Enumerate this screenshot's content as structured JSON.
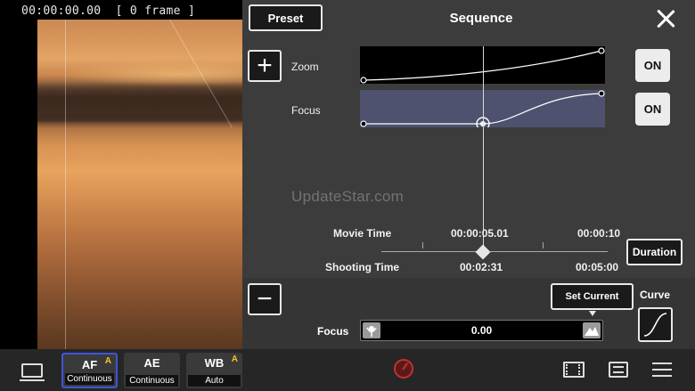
{
  "preview": {
    "timecode": "00:00:00.00",
    "frame_count": "[ 0 frame ]"
  },
  "sequence": {
    "title": "Sequence",
    "preset_label": "Preset",
    "close_icon": "close-icon",
    "add_label": "+",
    "remove_label": "−",
    "tracks": [
      {
        "label": "Zoom",
        "toggle": "ON"
      },
      {
        "label": "Focus",
        "toggle": "ON"
      }
    ],
    "watermark": "UpdateStar.com",
    "timeline": {
      "movie_time_label": "Movie Time",
      "shooting_time_label": "Shooting Time",
      "movie_time_current": "00:00:05.01",
      "movie_time_end": "00:00:10",
      "shooting_time_current": "00:02:31",
      "shooting_time_end": "00:05:00",
      "duration_label": "Duration"
    },
    "set_current_label": "Set Current",
    "curve_label": "Curve",
    "focus_slider": {
      "label": "Focus",
      "value": "0.00",
      "near_icon": "flower-icon",
      "far_icon": "mountain-icon"
    }
  },
  "toolbar": {
    "display_icon": "monitor-icon",
    "modes": [
      {
        "title": "AF",
        "sub": "Continuous",
        "warning": "A"
      },
      {
        "title": "AE",
        "sub": "Continuous"
      },
      {
        "title": "WB",
        "sub": "Auto",
        "warning": "A"
      }
    ],
    "record_icon": "record-icon",
    "film_icon": "film-icon",
    "adjust_icon": "adjust-icon",
    "menu_icon": "menu-icon"
  },
  "colors": {
    "panel_bg": "#3c3c3c",
    "focus_track_bg": "#4e526e",
    "af_selected_border": "#3f55d8",
    "record_red": "#c53030",
    "warning_yellow": "#f2c230"
  }
}
